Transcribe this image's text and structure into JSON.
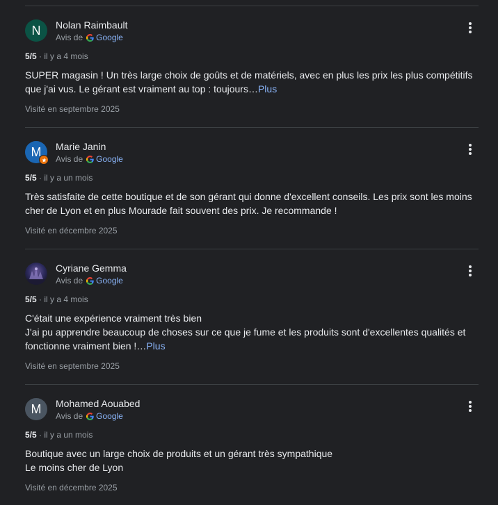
{
  "reviews": [
    {
      "author": "Nolan Raimbault",
      "avatar_letter": "N",
      "avatar_color": "#0b5345",
      "source_prefix": "Avis de",
      "source_name": "Google",
      "rating": "5/5",
      "time": "· il y a 4 mois",
      "lines": [
        "SUPER magasin ! Un très large choix de goûts et de matériels, avec en plus les prix les plus compétitifs",
        "que j'ai vus. Le gérant est vraiment au top : toujours…"
      ],
      "more_label": "Plus",
      "visited": "Visité en septembre 2025"
    },
    {
      "author": "Marie Janin",
      "avatar_letter": "M",
      "avatar_color": "#1a66b3",
      "source_prefix": "Avis de",
      "source_name": "Google",
      "rating": "5/5",
      "time": "· il y a un mois",
      "lines": [
        "Très satisfaite de cette boutique et de son gérant qui donne d'excellent conseils. Les prix sont les moins",
        "cher de Lyon et en plus Mourade fait souvent des prix. Je recommande !"
      ],
      "visited": "Visité en décembre 2025"
    },
    {
      "author": "Cyriane Gemma",
      "source_prefix": "Avis de",
      "source_name": "Google",
      "rating": "5/5",
      "time": "· il y a 4 mois",
      "lines": [
        "C'était une expérience vraiment très bien",
        "J'ai pu apprendre beaucoup de choses sur ce que je fume et les produits sont d'excellentes qualités et",
        "fonctionne vraiment bien !…"
      ],
      "more_label": "Plus",
      "visited": "Visité en septembre 2025"
    },
    {
      "author": "Mohamed Aouabed",
      "avatar_letter": "M",
      "avatar_color": "#4a5561",
      "source_prefix": "Avis de",
      "source_name": "Google",
      "rating": "5/5",
      "time": "· il y a un mois",
      "lines": [
        "Boutique avec un large choix de produits et un gérant très sympathique",
        "Le moins cher de Lyon"
      ],
      "visited": "Visité en décembre 2025"
    }
  ]
}
